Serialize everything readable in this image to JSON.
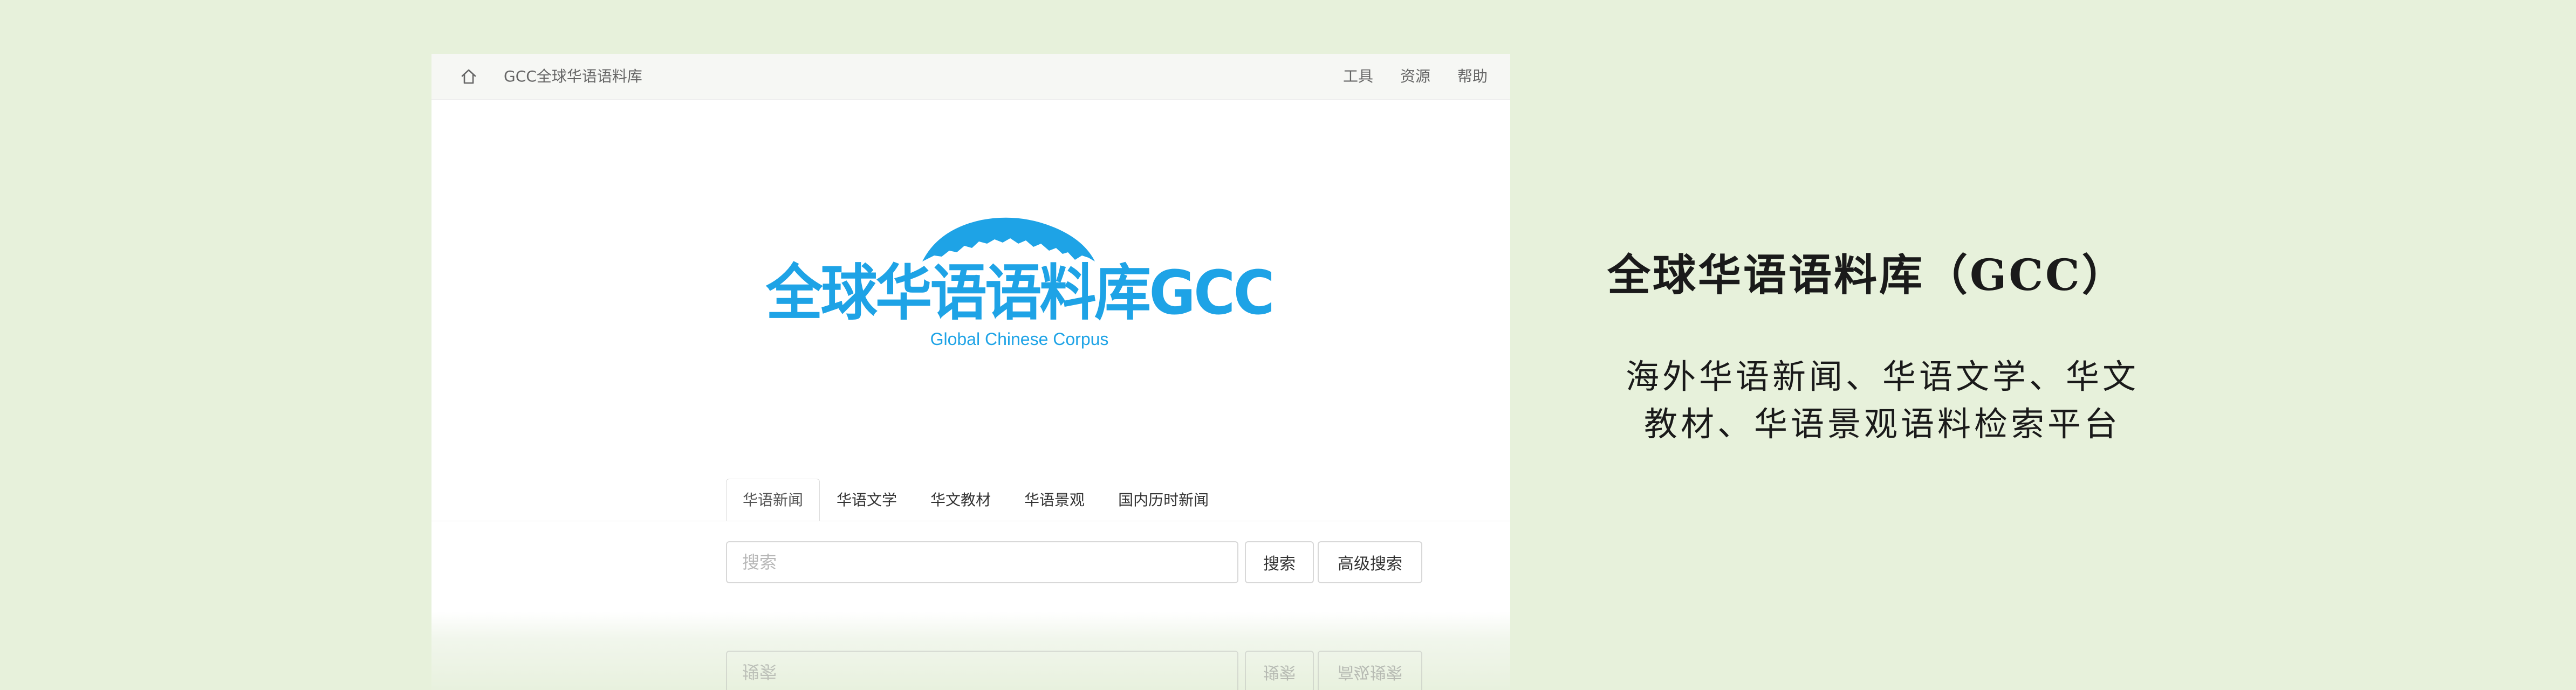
{
  "header": {
    "home_icon": "home-icon",
    "site_name": "GCC全球华语语料库",
    "links": [
      "工具",
      "资源",
      "帮助"
    ]
  },
  "logo": {
    "title": "全球华语语料库GCC",
    "subtitle": "Global Chinese Corpus",
    "color": "#1ea3e6"
  },
  "tabs": [
    {
      "label": "华语新闻",
      "active": true
    },
    {
      "label": "华语文学",
      "active": false
    },
    {
      "label": "华文教材",
      "active": false
    },
    {
      "label": "华语景观",
      "active": false
    },
    {
      "label": "国内历时新闻",
      "active": false
    }
  ],
  "search": {
    "placeholder": "搜索",
    "search_label": "搜索",
    "advanced_label": "高级搜索"
  },
  "caption": {
    "title": "全球华语语料库（GCC）",
    "subtitle_line1": "海外华语新闻、华语文学、华文",
    "subtitle_line2": "教材、华语景观语料检索平台"
  }
}
